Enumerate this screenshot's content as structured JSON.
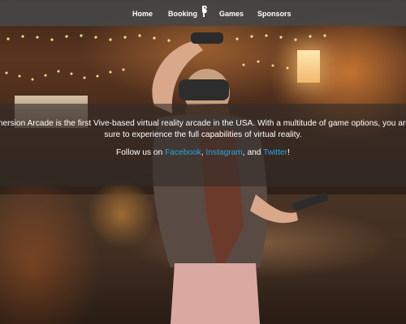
{
  "nav": {
    "items": [
      {
        "label": "Home"
      },
      {
        "label": "Booking"
      },
      {
        "label": "Games"
      },
      {
        "label": "Sponsors"
      }
    ],
    "logo_icon": "controller-logo-icon"
  },
  "banner": {
    "line1": "mersion Arcade is the first Vive-based virtual reality arcade in the USA. With a multitude of game options, you are",
    "line2": "sure to experience the full capabilities of virtual reality.",
    "follow_prefix": "Follow us on ",
    "facebook": "Facebook",
    "sep1": ", ",
    "instagram": "Instagram",
    "sep2": ", and ",
    "twitter": "Twitter",
    "suffix": "!"
  },
  "colors": {
    "nav_bg": "#464646",
    "link": "#2aa6e0",
    "text": "#ffffff"
  }
}
